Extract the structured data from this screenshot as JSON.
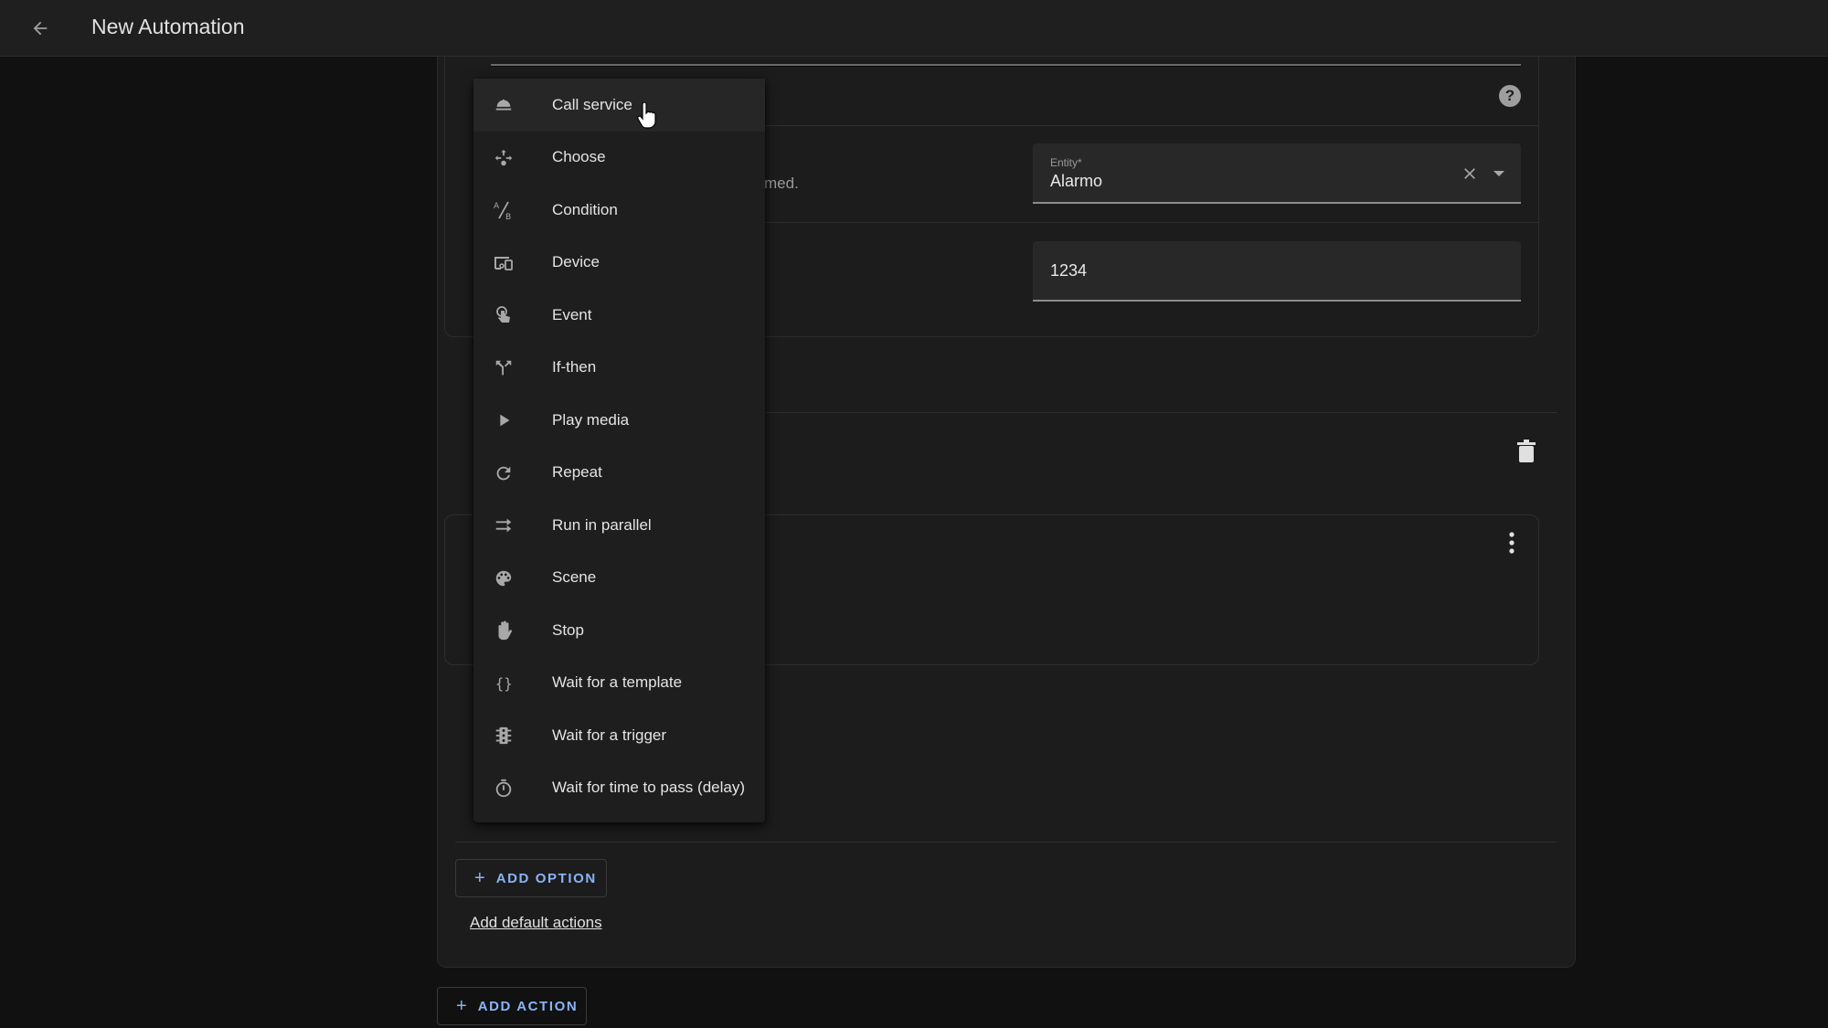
{
  "header": {
    "back_icon": "arrow-left-icon",
    "title": "New Automation"
  },
  "editor": {
    "description_fragment": "med.",
    "help_icon_glyph": "?",
    "entity_field": {
      "label": "Entity*",
      "value": "Alarmo"
    },
    "code_field": {
      "value": "1234"
    }
  },
  "menu": {
    "items": [
      {
        "label": "Call service",
        "icon": "bell-service-icon"
      },
      {
        "label": "Choose",
        "icon": "arrow-decision-icon"
      },
      {
        "label": "Condition",
        "icon": "a-b-testing-icon"
      },
      {
        "label": "Device",
        "icon": "devices-icon"
      },
      {
        "label": "Event",
        "icon": "gesture-tap-icon"
      },
      {
        "label": "If-then",
        "icon": "call-split-icon"
      },
      {
        "label": "Play media",
        "icon": "play-icon"
      },
      {
        "label": "Repeat",
        "icon": "refresh-icon"
      },
      {
        "label": "Run in parallel",
        "icon": "shuffle-disabled-icon"
      },
      {
        "label": "Scene",
        "icon": "palette-icon"
      },
      {
        "label": "Stop",
        "icon": "hand-back-right-icon"
      },
      {
        "label": "Wait for a template",
        "icon": "code-braces-icon"
      },
      {
        "label": "Wait for a trigger",
        "icon": "traffic-light-icon"
      },
      {
        "label": "Wait for time to pass (delay)",
        "icon": "timer-outline-icon"
      }
    ],
    "highlighted_index": 0
  },
  "buttons": {
    "add_option": "ADD OPTION",
    "add_default_actions": "Add default actions",
    "add_action": "ADD ACTION",
    "plus_glyph": "+"
  },
  "colors": {
    "accent": "#8ab4f8",
    "background": "#111111",
    "card": "#1c1c1c",
    "header": "#1f1f1f"
  }
}
